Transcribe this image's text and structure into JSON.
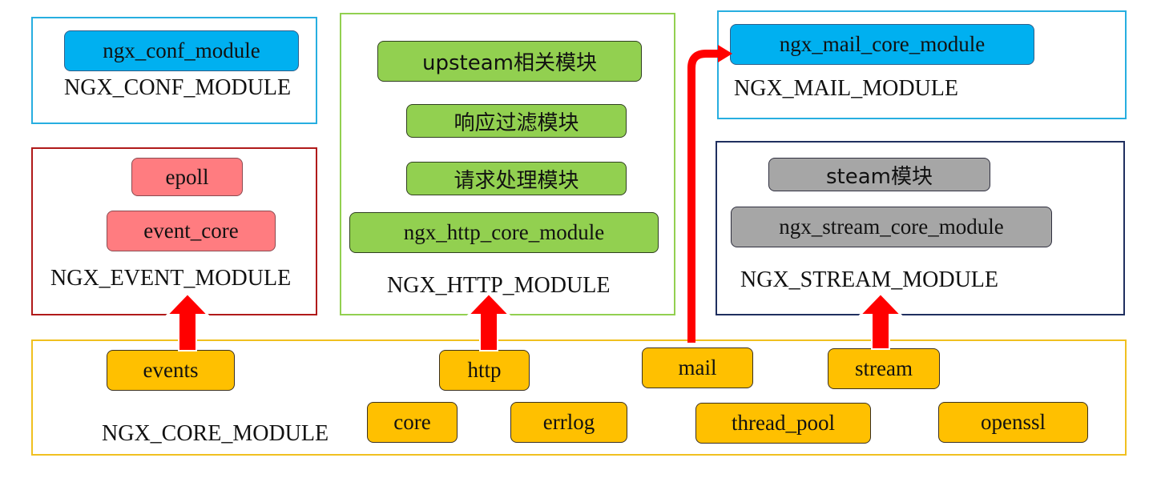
{
  "groups": {
    "conf": {
      "label": "NGX_CONF_MODULE",
      "color": "#27aee0",
      "modules": [
        "ngx_conf_module"
      ]
    },
    "event": {
      "label": "NGX_EVENT_MODULE",
      "color": "#b01a1a",
      "modules": [
        "epoll",
        "event_core"
      ]
    },
    "http": {
      "label": "NGX_HTTP_MODULE",
      "color": "#92d050",
      "modules": [
        "upsteam相关模块",
        "响应过滤模块",
        "请求处理模块",
        "ngx_http_core_module"
      ]
    },
    "mail": {
      "label": "NGX_MAIL_MODULE",
      "color": "#27aee0",
      "modules": [
        "ngx_mail_core_module"
      ]
    },
    "stream": {
      "label": "NGX_STREAM_MODULE",
      "color": "#1f2f5f",
      "modules": [
        "steam模块",
        "ngx_stream_core_module"
      ]
    },
    "core": {
      "label": "NGX_CORE_MODULE",
      "color": "#f0c020",
      "modules": [
        "events",
        "http",
        "mail",
        "stream",
        "core",
        "errlog",
        "thread_pool",
        "openssl"
      ]
    }
  },
  "arrows": [
    {
      "from": "events",
      "to": "NGX_EVENT_MODULE"
    },
    {
      "from": "http",
      "to": "NGX_HTTP_MODULE"
    },
    {
      "from": "mail",
      "to": "ngx_mail_core_module"
    },
    {
      "from": "stream",
      "to": "NGX_STREAM_MODULE"
    }
  ],
  "arrow_color": "#ff0000"
}
